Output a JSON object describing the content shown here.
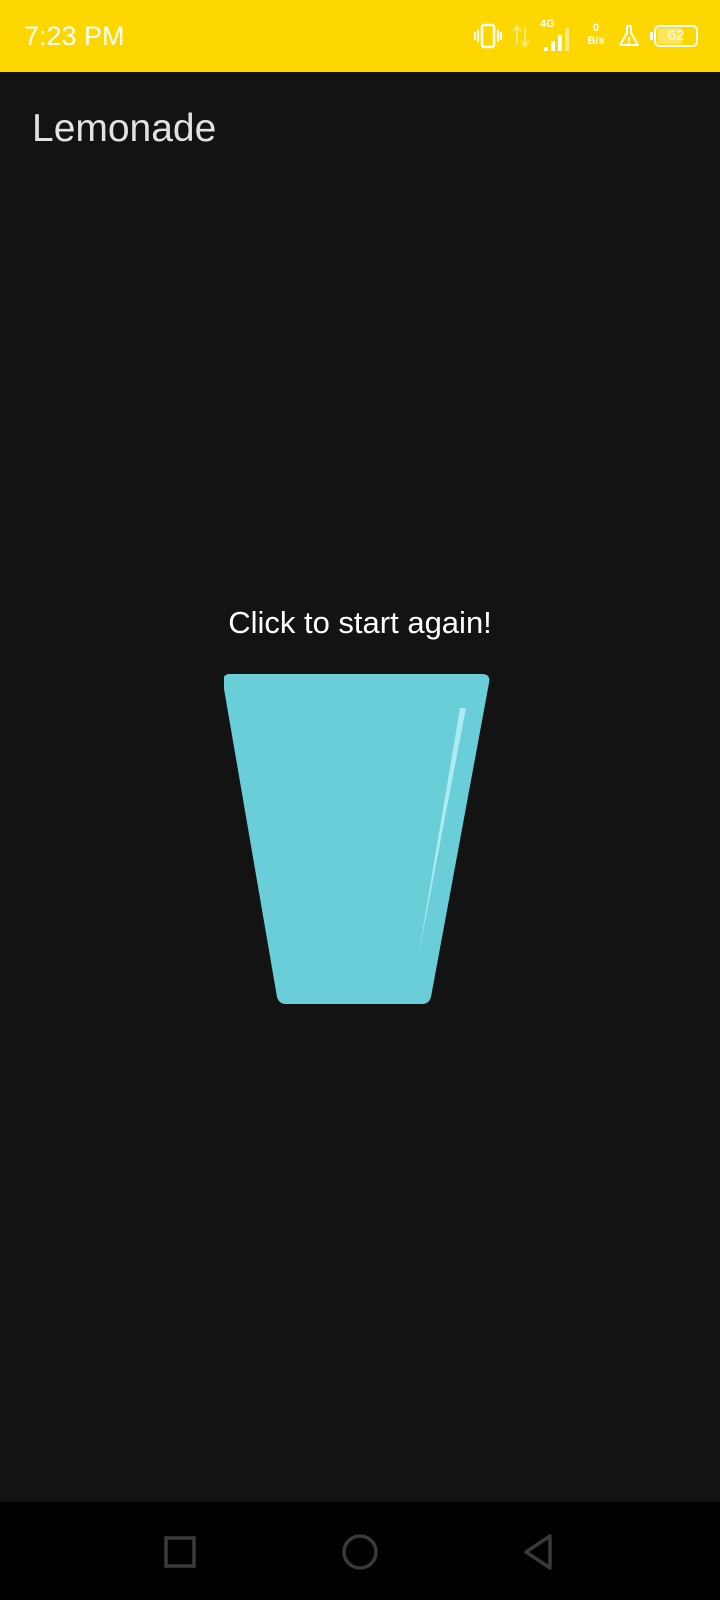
{
  "status_bar": {
    "time": "7:23 PM",
    "network_type": "4G",
    "speed_value": "0",
    "speed_unit": "B/s",
    "battery_level": "62",
    "background_color": "#ffd700",
    "icons": [
      "vibrate-icon",
      "data-arrows-icon",
      "signal-icon",
      "flask-icon",
      "battery-icon"
    ]
  },
  "app_bar": {
    "title": "Lemonade"
  },
  "main": {
    "instruction": "Click to start again!",
    "image_icon": "empty-glass-icon",
    "glass_color": "#69ced8"
  },
  "nav_bar": {
    "icons": [
      "recents-icon",
      "home-icon",
      "back-icon"
    ]
  }
}
